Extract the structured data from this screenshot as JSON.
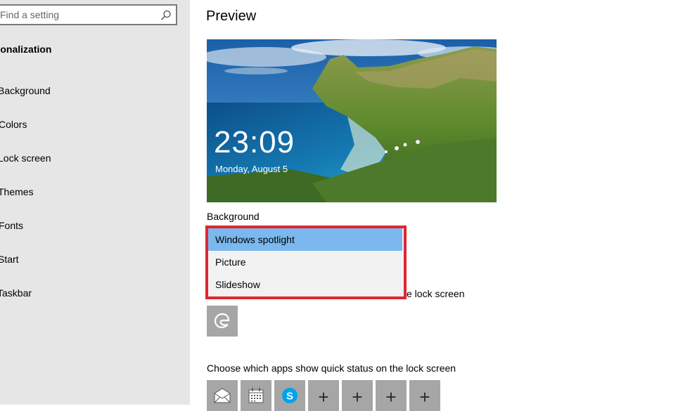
{
  "sidebar": {
    "search_placeholder": "Find a setting",
    "title": "Personalization",
    "items": [
      {
        "label": "Background"
      },
      {
        "label": "Colors"
      },
      {
        "label": "Lock screen"
      },
      {
        "label": "Themes"
      },
      {
        "label": "Fonts"
      },
      {
        "label": "Start"
      },
      {
        "label": "Taskbar"
      }
    ]
  },
  "main": {
    "title": "Preview",
    "preview": {
      "time": "23:09",
      "date": "Monday, August 5"
    },
    "background_label": "Background",
    "dropdown": {
      "options": [
        {
          "label": "Windows spotlight",
          "selected": true
        },
        {
          "label": "Picture"
        },
        {
          "label": "Slideshow"
        }
      ]
    },
    "detailed_status_tail": "e lock screen",
    "detailed_app_icon": "edge-icon",
    "quick_status_label": "Choose which apps show quick status on the lock screen",
    "quick_apps": [
      {
        "icon": "mail-icon"
      },
      {
        "icon": "calendar-icon"
      },
      {
        "icon": "skype-icon"
      },
      {
        "icon": "plus-icon"
      },
      {
        "icon": "plus-icon"
      },
      {
        "icon": "plus-icon"
      },
      {
        "icon": "plus-icon"
      }
    ]
  },
  "colors": {
    "accent_selection": "#7ab8ef",
    "highlight_border": "#e0262f",
    "tile": "#a6a6a6",
    "sidebar": "#e6e6e6"
  }
}
